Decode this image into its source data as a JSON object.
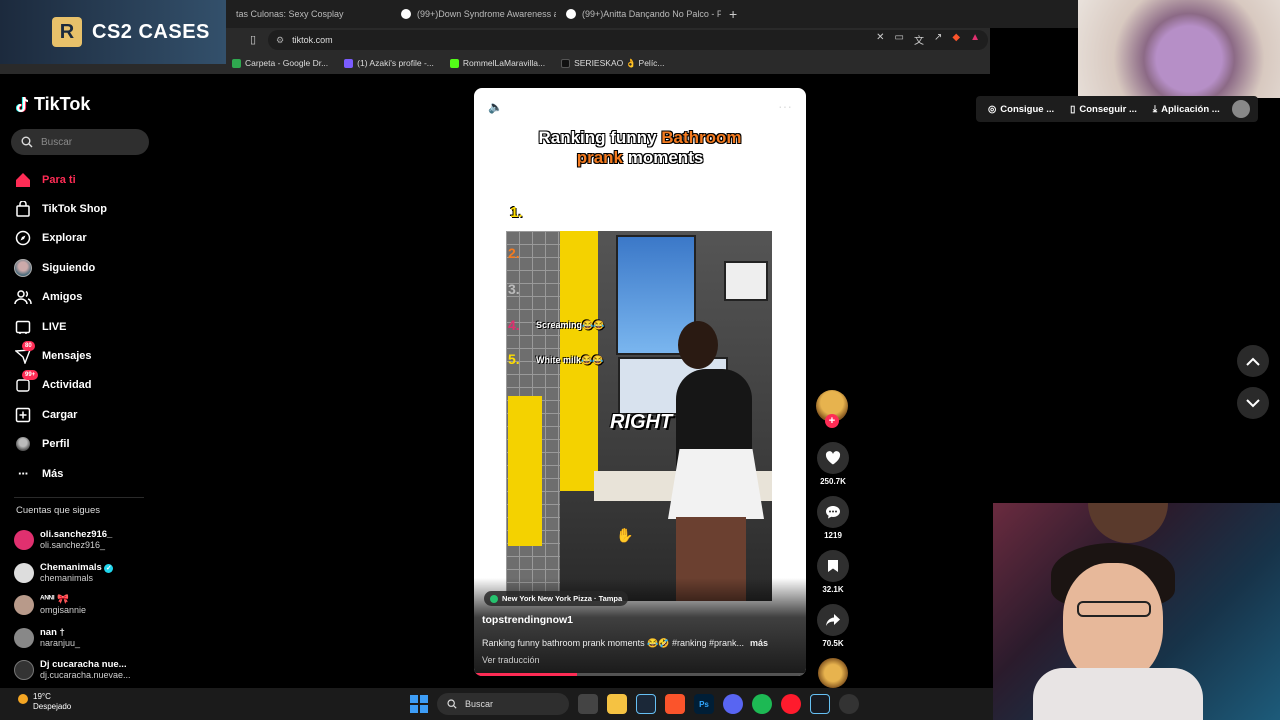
{
  "browser": {
    "tabs": [
      {
        "label": "tas Culonas: Sexy Cosplay"
      },
      {
        "label": "(99+)Down Syndrome Awareness at"
      },
      {
        "label": "(99+)Anitta Dançando No Palco - Pe"
      }
    ],
    "url": "tiktok.com",
    "bookmarks": [
      {
        "label": "Carpeta - Google Dr...",
        "color": "#2fa84f"
      },
      {
        "label": "(1) Azaki's profile -...",
        "color": "#7b5cff"
      },
      {
        "label": "RommelLaMaravilla...",
        "color": "#53fc18"
      },
      {
        "label": "SERIESKAO 👌 Pelíc...",
        "color": "#111111"
      }
    ]
  },
  "overlay": {
    "cs2_logo": "R",
    "cs2_text": "CS2 CASES"
  },
  "sidebar": {
    "brand": "TikTok",
    "search_placeholder": "Buscar",
    "nav": [
      {
        "label": "Para ti",
        "icon": "home-icon",
        "active": true
      },
      {
        "label": "TikTok Shop",
        "icon": "shop-icon"
      },
      {
        "label": "Explorar",
        "icon": "compass-icon"
      },
      {
        "label": "Siguiendo",
        "icon": "following-avatar-icon"
      },
      {
        "label": "Amigos",
        "icon": "friends-icon"
      },
      {
        "label": "LIVE",
        "icon": "live-icon"
      },
      {
        "label": "Mensajes",
        "icon": "messages-icon",
        "badge": "80"
      },
      {
        "label": "Actividad",
        "icon": "activity-icon",
        "badge": "99+"
      },
      {
        "label": "Cargar",
        "icon": "upload-icon"
      },
      {
        "label": "Perfil",
        "icon": "profile-icon"
      },
      {
        "label": "Más",
        "icon": "more-icon"
      }
    ],
    "following_title": "Cuentas que sigues",
    "following": [
      {
        "name": "oli.sanchez916_",
        "handle": "oli.sanchez916_",
        "color": "#e0306f"
      },
      {
        "name": "Chemanimals",
        "handle": "chemanimals",
        "color": "#dddddd",
        "verified": true
      },
      {
        "name": "ᴬᴺᴺᴵ 🎀",
        "handle": "omgisannie",
        "color": "#b89a8a"
      },
      {
        "name": "nan †",
        "handle": "naranjuu_",
        "color": "#888888"
      },
      {
        "name": "Dj cucaracha nue...",
        "handle": "dj.cucaracha.nuevae...",
        "color": "#333333"
      }
    ]
  },
  "video": {
    "title_line1_a": "Ranking funny ",
    "title_line1_b": "Bathroom",
    "title_line2_a": "prank",
    "title_line2_b": " moments",
    "rank_1": "1.",
    "ranks": [
      {
        "num": "2.",
        "text": "",
        "color": "#f47b20"
      },
      {
        "num": "3.",
        "text": "",
        "color": "#bbbbbb"
      },
      {
        "num": "4.",
        "text": "Screaming😂😂",
        "color": "#e0306f"
      },
      {
        "num": "5.",
        "text": "White milk😂😂",
        "color": "#ffde00"
      }
    ],
    "overlay_word": "RIGHT",
    "location": "New York New York Pizza · Tampa",
    "author": "topstrendingnow1",
    "description": "Ranking funny bathroom prank moments 😂🤣 #ranking #prank...",
    "more_label": "más",
    "translate_label": "Ver traducción",
    "progress": 0.31
  },
  "actions": {
    "likes": "250.7K",
    "comments": "1219",
    "saves": "32.1K",
    "shares": "70.5K"
  },
  "topbar": {
    "coins": "Consigue ...",
    "get_app": "Conseguir ...",
    "app": "Aplicación ..."
  },
  "taskbar": {
    "temp": "19°C",
    "weather": "Despejado",
    "search": "Buscar"
  }
}
